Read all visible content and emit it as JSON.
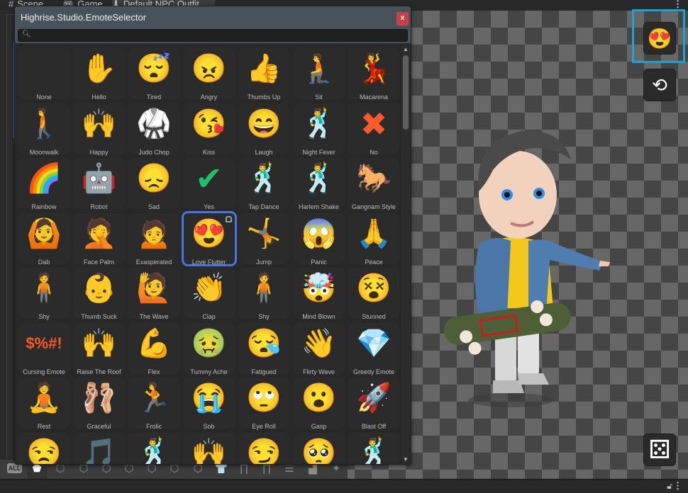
{
  "tabs": [
    {
      "label": "Scene",
      "icon": "grid-icon"
    },
    {
      "label": "Game",
      "icon": "gamepad-icon"
    },
    {
      "label": "Default NPC Outfit",
      "icon": "person-icon"
    }
  ],
  "dialog": {
    "title": "Highrise.Studio.EmoteSelector",
    "close_label": "x",
    "search": {
      "value": "",
      "placeholder": ""
    }
  },
  "emotes": [
    {
      "label": "None",
      "glyph": ""
    },
    {
      "label": "Hello",
      "glyph": "✋"
    },
    {
      "label": "Tired",
      "glyph": "😴"
    },
    {
      "label": "Angry",
      "glyph": "😠"
    },
    {
      "label": "Thumbs Up",
      "glyph": "👍"
    },
    {
      "label": "Sit",
      "glyph": "🧎"
    },
    {
      "label": "Macarena",
      "glyph": "💃"
    },
    {
      "label": "Moonwalk",
      "glyph": "🚶"
    },
    {
      "label": "Happy",
      "glyph": "🙌"
    },
    {
      "label": "Judo Chop",
      "glyph": "🥋"
    },
    {
      "label": "Kiss",
      "glyph": "😘"
    },
    {
      "label": "Laugh",
      "glyph": "😄"
    },
    {
      "label": "Night Fever",
      "glyph": "🕺"
    },
    {
      "label": "No",
      "glyph": "✖"
    },
    {
      "label": "Rainbow",
      "glyph": "🌈"
    },
    {
      "label": "Robot",
      "glyph": "🤖"
    },
    {
      "label": "Sad",
      "glyph": "😞"
    },
    {
      "label": "Yes",
      "glyph": "✔"
    },
    {
      "label": "Tap Dance",
      "glyph": "🕺"
    },
    {
      "label": "Harlem Shake",
      "glyph": "🕺"
    },
    {
      "label": "Gangnam Style",
      "glyph": "🐎"
    },
    {
      "label": "Dab",
      "glyph": "🙆"
    },
    {
      "label": "Face Palm",
      "glyph": "🤦"
    },
    {
      "label": "Exasperated",
      "glyph": "🙍"
    },
    {
      "label": "Love Flutter",
      "glyph": "😍",
      "selected": true
    },
    {
      "label": "Jump",
      "glyph": "🤸"
    },
    {
      "label": "Panic",
      "glyph": "😱"
    },
    {
      "label": "Peace",
      "glyph": "🙏"
    },
    {
      "label": "Shy",
      "glyph": "🧍"
    },
    {
      "label": "Thumb Suck",
      "glyph": "👶"
    },
    {
      "label": "The Wave",
      "glyph": "🙋"
    },
    {
      "label": "Clap",
      "glyph": "👏"
    },
    {
      "label": "Shy",
      "glyph": "🧍"
    },
    {
      "label": "Mind Blown",
      "glyph": "🤯"
    },
    {
      "label": "Stunned",
      "glyph": "😵"
    },
    {
      "label": "Cursing Emote",
      "glyph": "$%#!"
    },
    {
      "label": "Raise The Roof",
      "glyph": "🙌"
    },
    {
      "label": "Flex",
      "glyph": "💪"
    },
    {
      "label": "Tummy Ache",
      "glyph": "🤢"
    },
    {
      "label": "Fatigued",
      "glyph": "😪"
    },
    {
      "label": "Flirty Wave",
      "glyph": "👋"
    },
    {
      "label": "Greedy Emote",
      "glyph": "💎"
    },
    {
      "label": "Rest",
      "glyph": "🧘"
    },
    {
      "label": "Graceful",
      "glyph": "🩰"
    },
    {
      "label": "Frolic",
      "glyph": "🏃"
    },
    {
      "label": "Sob",
      "glyph": "😭"
    },
    {
      "label": "Eye Roll",
      "glyph": "🙄"
    },
    {
      "label": "Gasp",
      "glyph": "😮"
    },
    {
      "label": "Blast Off",
      "glyph": "🚀"
    },
    {
      "label": "",
      "glyph": "😒"
    },
    {
      "label": "",
      "glyph": "🎵"
    },
    {
      "label": "",
      "glyph": "🕺"
    },
    {
      "label": "",
      "glyph": "🙌"
    },
    {
      "label": "",
      "glyph": "😏"
    },
    {
      "label": "",
      "glyph": "🥺"
    },
    {
      "label": "",
      "glyph": "🕺"
    }
  ],
  "categories": [
    {
      "name": "all",
      "label": "ALL",
      "glyph": "ALL"
    },
    {
      "name": "body",
      "glyph": "⬟",
      "active": true
    },
    {
      "name": "face-shape",
      "glyph": "⬡"
    },
    {
      "name": "ears",
      "glyph": "⬡"
    },
    {
      "name": "eyes",
      "glyph": "⬡"
    },
    {
      "name": "eyebrows",
      "glyph": "⬡"
    },
    {
      "name": "nose",
      "glyph": "⬡"
    },
    {
      "name": "mouth",
      "glyph": "⬡"
    },
    {
      "name": "face-accessories",
      "glyph": "⬡"
    },
    {
      "name": "shirt",
      "glyph": "👕"
    },
    {
      "name": "pants",
      "glyph": "∏"
    },
    {
      "name": "legs",
      "glyph": "∏"
    },
    {
      "name": "belt",
      "glyph": "☰"
    },
    {
      "name": "shoes",
      "glyph": "▟"
    },
    {
      "name": "effects",
      "glyph": "✦"
    }
  ],
  "viewport": {
    "emote_button_icon": "😍",
    "rotate_button_icon": "⟲",
    "randomize_button_icon": "⚄"
  },
  "colors": {
    "accent_blue": "#4a75e0",
    "highlight_cyan": "#1aa3d0",
    "close_red": "#c8404a",
    "emote_teal": "#00c2c2"
  }
}
